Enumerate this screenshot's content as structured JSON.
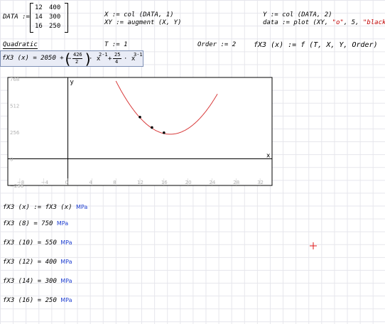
{
  "matrix": {
    "name": "DATA",
    "assign": ":=",
    "rows": [
      [
        "12",
        "400"
      ],
      [
        "14",
        "300"
      ],
      [
        "16",
        "250"
      ]
    ]
  },
  "defs": {
    "x_def": "X := col (DATA, 1)",
    "xy_lhs": "XY",
    "xy_rhs": ":= augment (X, Y)",
    "y_def": "Y := col (DATA, 2)",
    "data_def": "data := plot (XY, ",
    "data_str1": "\"o\"",
    "data_mid": ", 5, ",
    "data_str2": "\"black\"",
    "data_end": ")"
  },
  "fit": {
    "label": "Quadratic",
    "t_def": "T := 1",
    "order_def": "Order := 2",
    "fx_def": "fX3 (x) := f (T, X, Y, Order)",
    "formula": {
      "lhs": "fX3 (x) = 2050 + ",
      "num1": "426",
      "den1": "2",
      "pow1": "2-1",
      "num2": "25",
      "den2": "4",
      "pow2": "3-1"
    }
  },
  "plot": {
    "y_axis_label": "y",
    "x_axis_label": "x",
    "y_ticks": [
      "768",
      "512",
      "256",
      "0",
      "−256"
    ],
    "x_ticks": [
      "−8",
      "−4",
      "0",
      "4",
      "8",
      "12",
      "16",
      "20",
      "24",
      "28",
      "32"
    ]
  },
  "chart_data": {
    "type": "line",
    "xlabel": "x",
    "ylabel": "y",
    "xlim": [
      -10,
      34
    ],
    "ylim": [
      -256,
      780
    ],
    "series": [
      {
        "function": "2050 - 213*x + 6.25*x^2",
        "x_range": [
          8,
          25
        ],
        "color": "#d83a3a"
      }
    ],
    "points": [
      [
        12,
        400
      ],
      [
        14,
        300
      ],
      [
        16,
        250
      ]
    ],
    "x_ticks": [
      -8,
      -4,
      0,
      4,
      8,
      12,
      16,
      20,
      24,
      28,
      32
    ],
    "y_ticks": [
      -256,
      0,
      256,
      512,
      768
    ],
    "grid": false
  },
  "results": [
    {
      "lhs": "fX3 (x) := fX3 (x)",
      "unit": "MPa"
    },
    {
      "lhs": "fX3 (8) = 750",
      "unit": "MPa"
    },
    {
      "lhs": "fX3 (10) = 550",
      "unit": "MPa"
    },
    {
      "lhs": "fX3 (12) = 400",
      "unit": "MPa"
    },
    {
      "lhs": "fX3 (14) = 300",
      "unit": "MPa"
    },
    {
      "lhs": "fX3 (16) = 250",
      "unit": "MPa"
    }
  ],
  "colors": {
    "curve": "#d83a3a",
    "unit": "#1f3fd0",
    "cursor": "#e01818",
    "box": "#e9ecf6"
  },
  "icons": {
    "cursor": "crosshair-cursor-icon"
  }
}
